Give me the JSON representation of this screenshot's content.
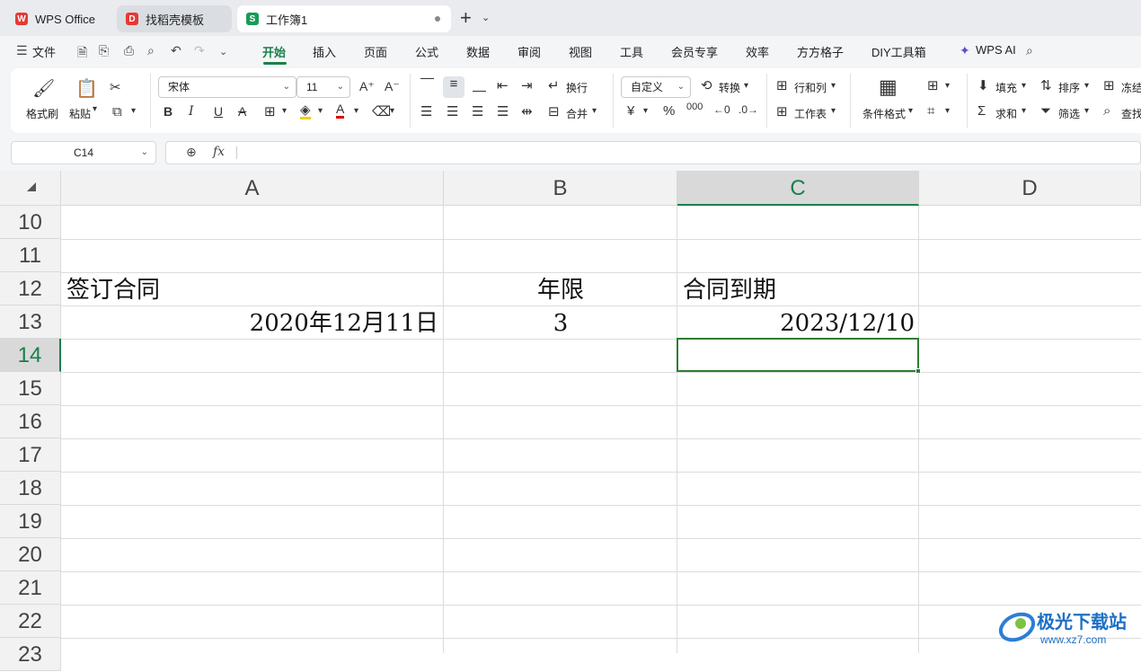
{
  "tabs": {
    "wps": "WPS Office",
    "template": "找稻壳模板",
    "workbook": "工作簿1"
  },
  "menu": {
    "file": "文件",
    "items": [
      "开始",
      "插入",
      "页面",
      "公式",
      "数据",
      "审阅",
      "视图",
      "工具",
      "会员专享",
      "效率",
      "方方格子",
      "DIY工具箱"
    ],
    "ai": "WPS AI"
  },
  "ribbon": {
    "format_painter": "格式刷",
    "paste": "粘贴",
    "font_name": "宋体",
    "font_size": "11",
    "wrap": "换行",
    "merge": "合并",
    "number_format": "自定义",
    "convert": "转换",
    "row_col": "行和列",
    "worksheet": "工作表",
    "cond_format": "条件格式",
    "fill": "填充",
    "sort": "排序",
    "freeze": "冻结",
    "sum": "求和",
    "filter": "筛选",
    "find": "查找",
    "bold": "B",
    "italic": "I",
    "underline": "U",
    "currency": "¥",
    "percent": "%",
    "thousands": "000"
  },
  "formula_bar": {
    "cell_ref": "C14",
    "fx": "fx",
    "content": ""
  },
  "sheet": {
    "columns": [
      "A",
      "B",
      "C",
      "D"
    ],
    "rows": [
      "10",
      "11",
      "12",
      "13",
      "14",
      "15",
      "16",
      "17",
      "18",
      "19",
      "20",
      "21",
      "22",
      "23"
    ],
    "cells": {
      "A12": "签订合同",
      "B12": "年限",
      "C12": "合同到期",
      "A13": "2020年12月11日",
      "B13": "3",
      "C13": "2023/12/10"
    }
  },
  "watermark": {
    "title": "极光下载站",
    "url": "www.xz7.com"
  },
  "colors": {
    "accent": "#1a7f4b",
    "selection": "#2e7d32"
  }
}
